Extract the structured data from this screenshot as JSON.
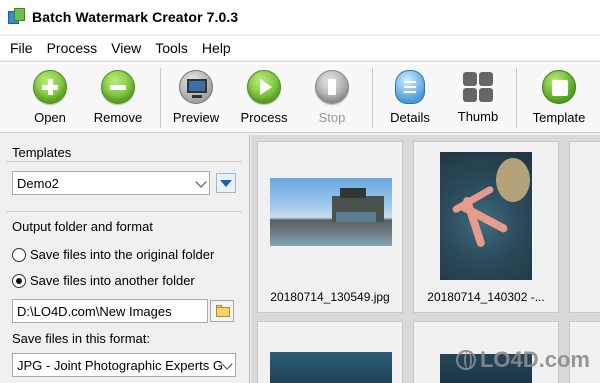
{
  "window": {
    "title": "Batch Watermark Creator 7.0.3"
  },
  "menu": [
    "File",
    "Process",
    "View",
    "Tools",
    "Help"
  ],
  "toolbar": {
    "open": "Open",
    "remove": "Remove",
    "preview": "Preview",
    "process": "Process",
    "stop": "Stop",
    "details": "Details",
    "thumb": "Thumb",
    "template": "Template"
  },
  "templates": {
    "group_title": "Templates",
    "selected": "Demo2"
  },
  "output": {
    "group_title": "Output folder and format",
    "option_original": "Save files into the original folder",
    "option_another": "Save files into another folder",
    "selected_option": "another",
    "folder_path": "D:\\LO4D.com\\New Images",
    "format_label": "Save files in this format:",
    "format_selected": "JPG - Joint Photographic Experts G"
  },
  "thumbnails": [
    {
      "caption": "20180714_130549.jpg"
    },
    {
      "caption": "20180714_140302 -..."
    },
    {
      "caption": ""
    },
    {
      "caption": ""
    }
  ],
  "watermark": {
    "text": "LO4D.com"
  },
  "colors": {
    "accent_green": "#6cba2a",
    "accent_blue": "#4e9ee0",
    "background": "#f0f0f0",
    "thumb_bg": "#d9d9d9"
  }
}
